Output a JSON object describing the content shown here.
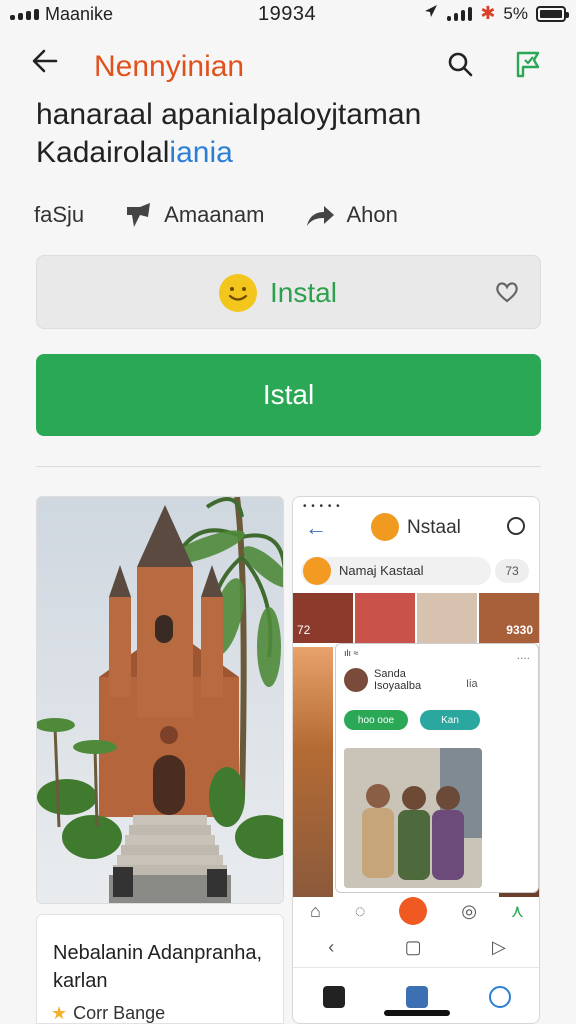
{
  "status_bar": {
    "carrier": "Maanike",
    "time": "19934",
    "battery": "5%"
  },
  "topbar": {
    "title": "Nennyinian",
    "back_icon": "arrow-left-icon",
    "search_icon": "search-icon",
    "flag_icon": "bookmark-flag-icon"
  },
  "heading": {
    "line1": "hanaraal apaniaIpaloyjtaman",
    "line2_main": "Kadairolal",
    "line2_accent": "iania"
  },
  "meta": [
    {
      "label": "faSju"
    },
    {
      "label": "Amaanam",
      "icon": "thumb-icon"
    },
    {
      "label": "Ahon",
      "icon": "share-arrow-icon"
    }
  ],
  "install_card": {
    "label": "Instal"
  },
  "install_button": {
    "label": "Istal"
  },
  "caption_card": {
    "caption": "Nebalanin Adanpranha, karlan",
    "tag": "Corr Bange"
  },
  "phone_preview": {
    "title": "Nstaal",
    "search_text": "Namaj Kastaal",
    "chip": "73",
    "gallery_count": "9330",
    "gallery_left": "72",
    "inner_status": "ılı ≈",
    "inner_user_line1": "Sanda",
    "inner_user_line2": "Isoyaalba",
    "inner_mini": "Iia",
    "pill1": "hoo ooe",
    "pill2": "Kan",
    "inner_opts": "...."
  },
  "colors": {
    "accent_orange": "#e0521d",
    "accent_green": "#2aa855",
    "accent_blue": "#2a7fd4"
  }
}
